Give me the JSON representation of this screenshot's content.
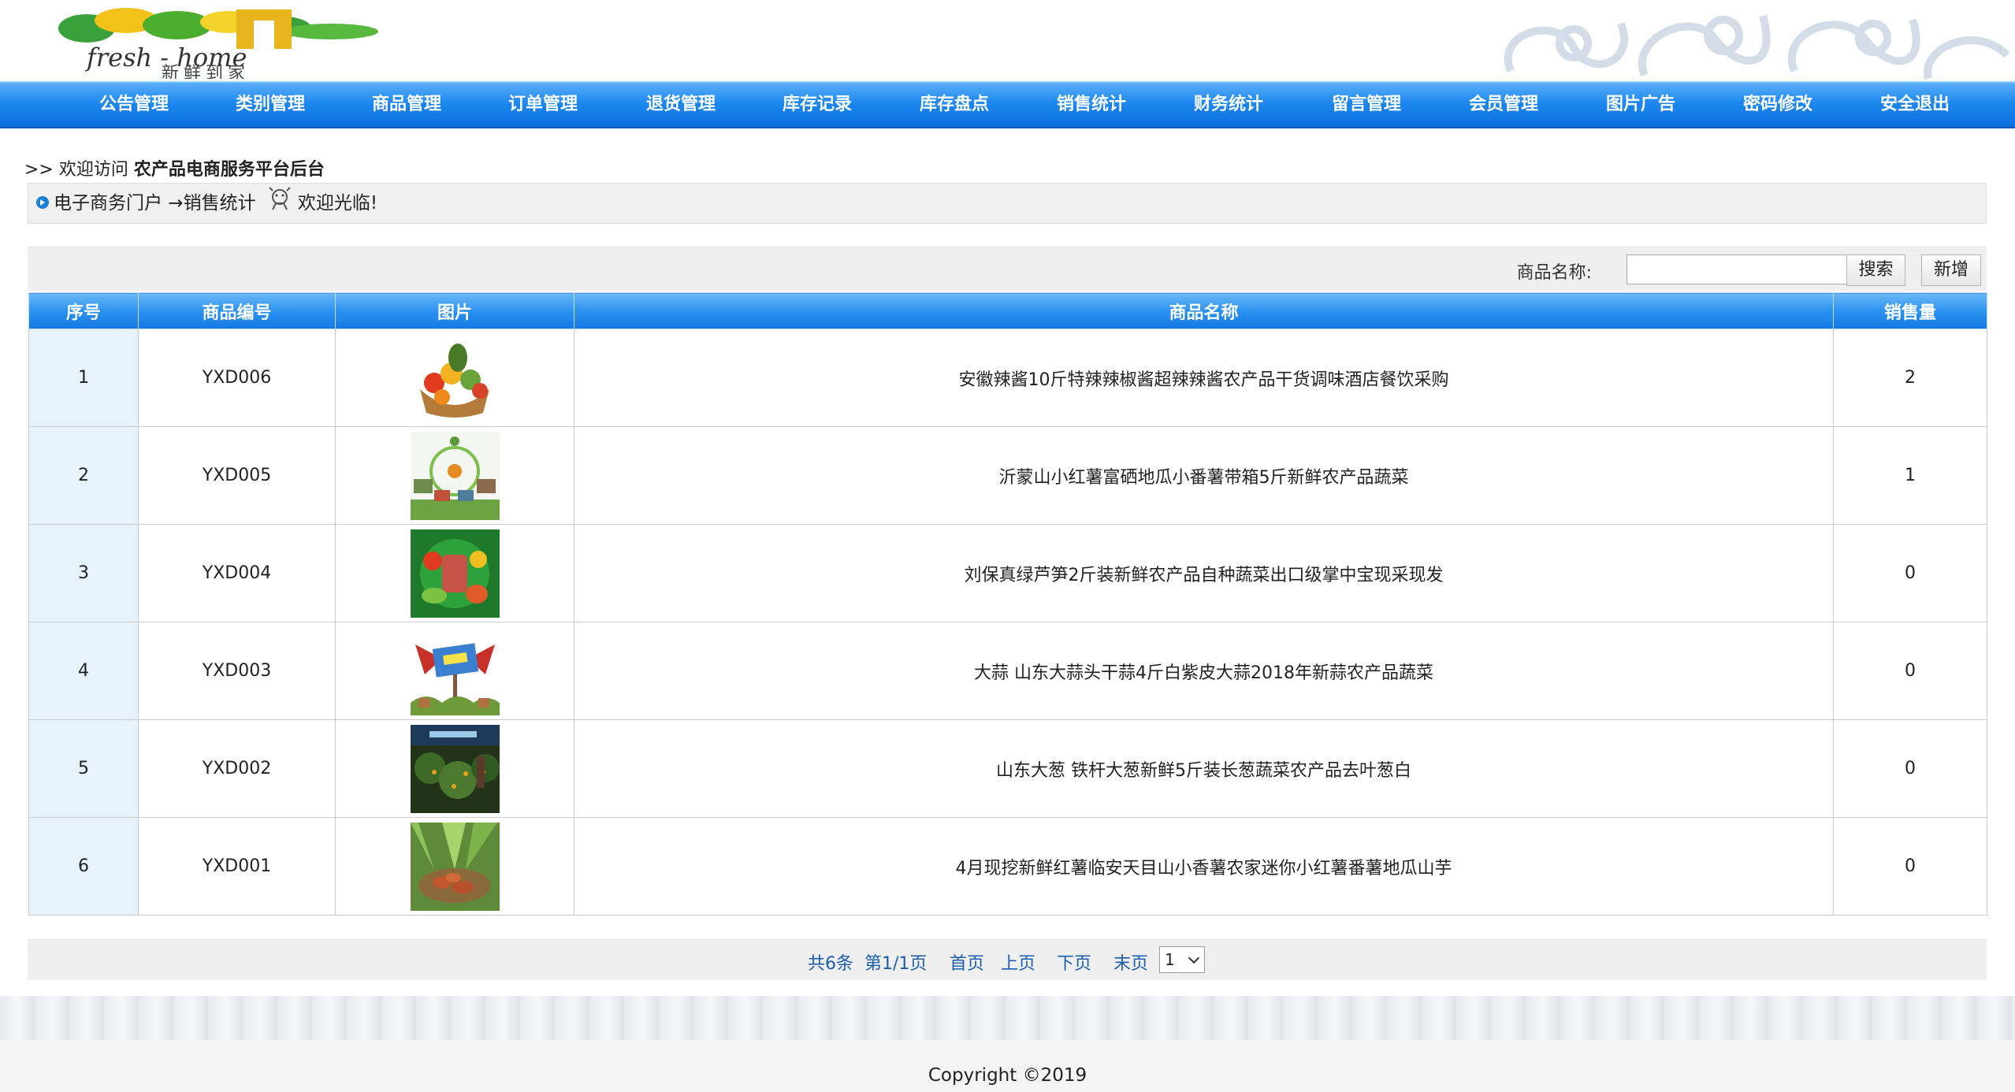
{
  "header": {
    "logo_text_en": "fresh-home",
    "logo_text_cn": "新鲜到家"
  },
  "nav": [
    {
      "label": "公告管理"
    },
    {
      "label": "类别管理"
    },
    {
      "label": "商品管理"
    },
    {
      "label": "订单管理"
    },
    {
      "label": "退货管理"
    },
    {
      "label": "库存记录"
    },
    {
      "label": "库存盘点"
    },
    {
      "label": "销售统计"
    },
    {
      "label": "财务统计"
    },
    {
      "label": "留言管理"
    },
    {
      "label": "会员管理"
    },
    {
      "label": "图片广告"
    },
    {
      "label": "密码修改"
    },
    {
      "label": "安全退出"
    }
  ],
  "welcome": {
    "prefix": ">> 欢迎访问 ",
    "site_name": "农产品电商服务平台后台"
  },
  "breadcrumb": {
    "path": "电子商务门户 →销售统计",
    "greeting": "欢迎光临!"
  },
  "search": {
    "label": "商品名称:",
    "value": "",
    "search_button": "搜索",
    "add_button": "新增"
  },
  "table": {
    "headers": [
      "序号",
      "商品编号",
      "图片",
      "商品名称",
      "销售量"
    ],
    "rows": [
      {
        "index": "1",
        "code": "YXD006",
        "image": "fruit-basket-image",
        "name": "安徽辣酱10斤特辣辣椒酱超辣辣酱农产品干货调味酒店餐饮采购",
        "sales": "2"
      },
      {
        "index": "2",
        "code": "YXD005",
        "image": "farm-diagram-image",
        "name": "沂蒙山小红薯富硒地瓜小番薯带箱5斤新鲜农产品蔬菜",
        "sales": "1"
      },
      {
        "index": "3",
        "code": "YXD004",
        "image": "vegetable-juice-image",
        "name": "刘保真绿芦笋2斤装新鲜农产品自种蔬菜出口级掌中宝现采现发",
        "sales": "0"
      },
      {
        "index": "4",
        "code": "YXD003",
        "image": "banner-sign-image",
        "name": "大蒜 山东大蒜头干蒜4斤白紫皮大蒜2018年新蒜农产品蔬菜",
        "sales": "0"
      },
      {
        "index": "5",
        "code": "YXD002",
        "image": "orchard-image",
        "name": "山东大葱 铁杆大葱新鲜5斤装长葱蔬菜农产品去叶葱白",
        "sales": "0"
      },
      {
        "index": "6",
        "code": "YXD001",
        "image": "vegetable-harvest-image",
        "name": "4月现挖新鲜红薯临安天目山小香薯农家迷你小红薯番薯地瓜山芋",
        "sales": "0"
      }
    ]
  },
  "pagination": {
    "total": "共6条",
    "page_info": "第1/1页",
    "first": "首页",
    "prev": "上页",
    "next": "下页",
    "last": "末页",
    "selected_page": "1"
  },
  "footer": {
    "copyright": "Copyright ©2019"
  },
  "colors": {
    "nav_blue": "#1e88ef",
    "header_blue": "#2b92f0",
    "link_blue": "#1b5eae"
  }
}
